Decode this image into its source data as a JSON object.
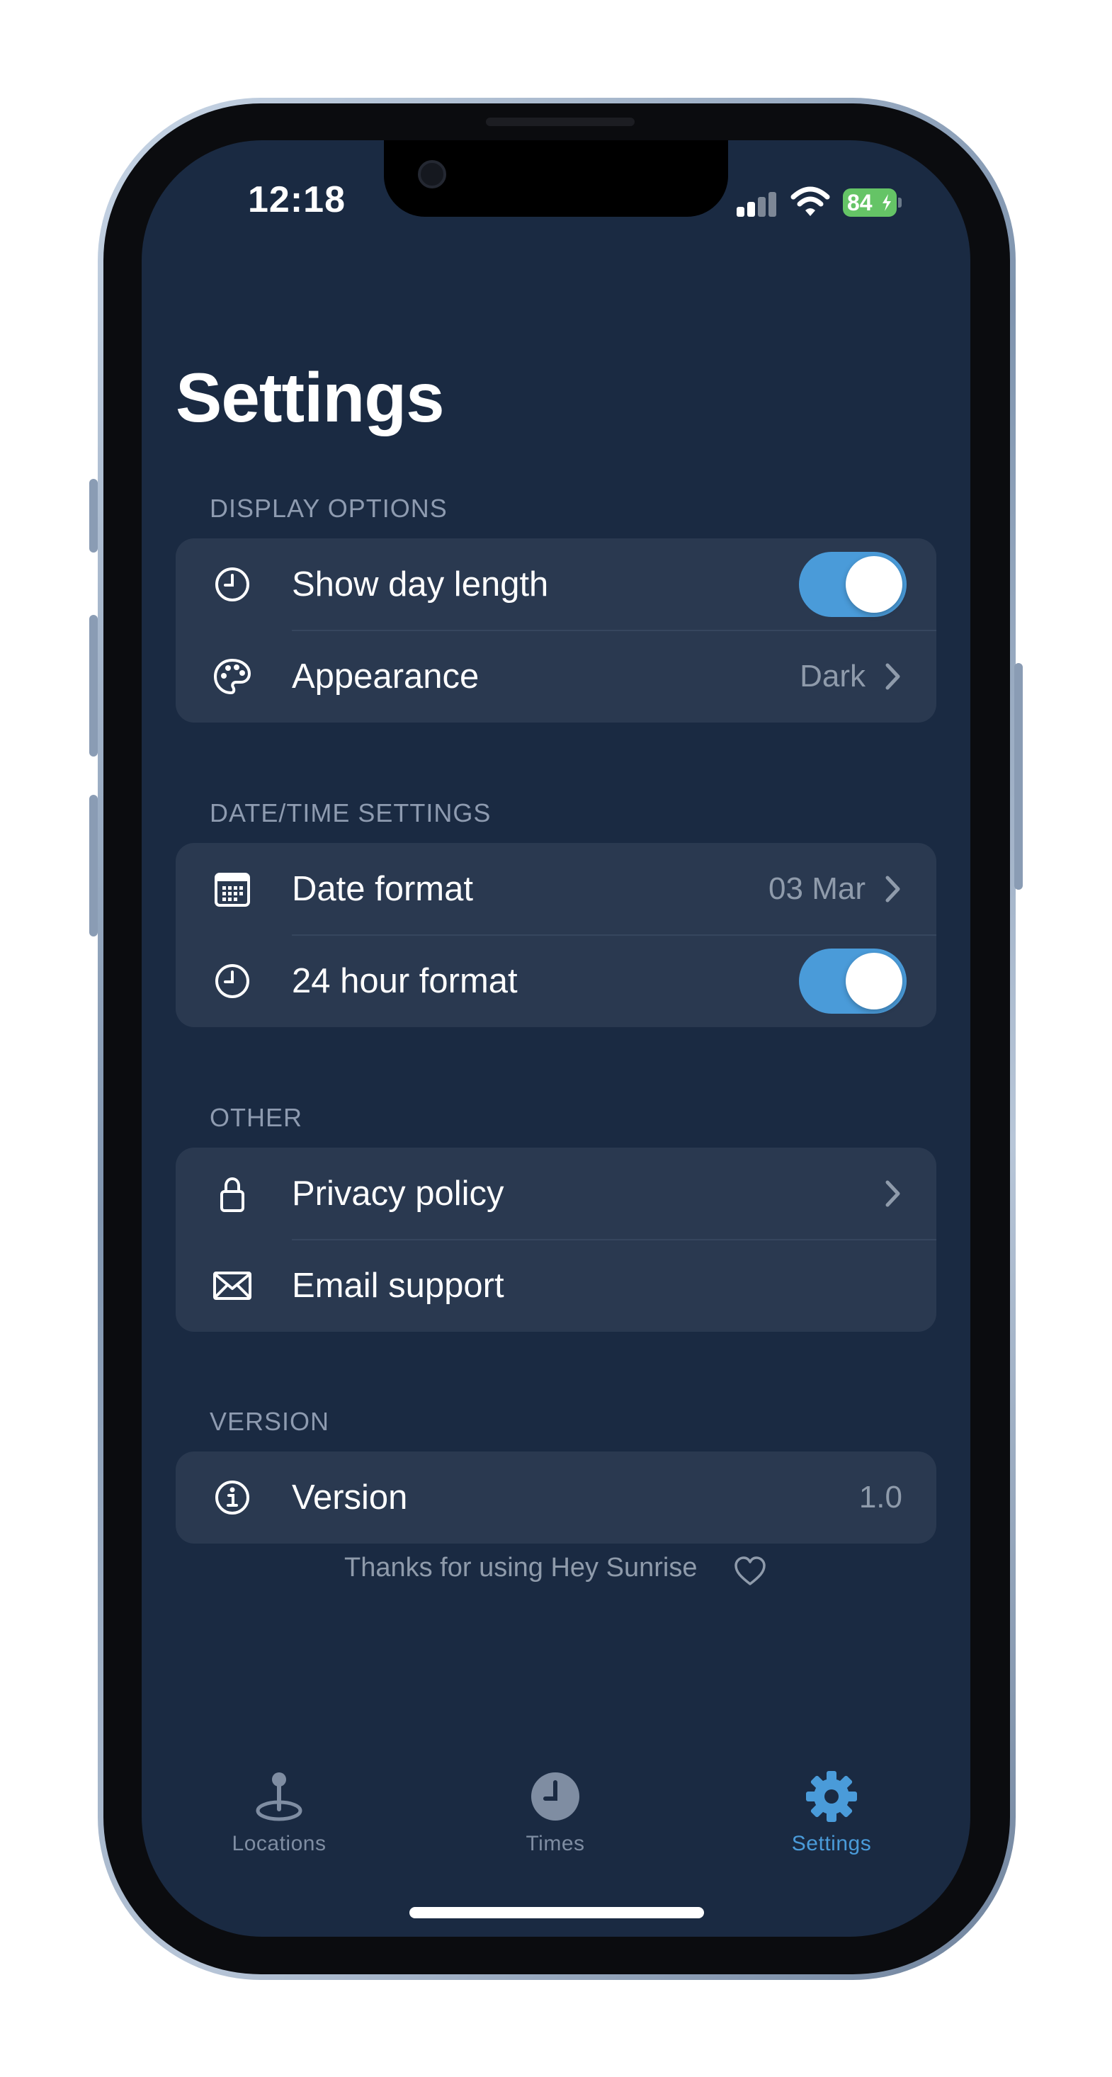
{
  "status_bar": {
    "time": "12:18",
    "battery": "84"
  },
  "page": {
    "title": "Settings"
  },
  "sections": [
    {
      "header": "DISPLAY OPTIONS"
    },
    {
      "header": "DATE/TIME SETTINGS"
    },
    {
      "header": "OTHER"
    },
    {
      "header": "VERSION"
    }
  ],
  "rows": {
    "show_day_length": {
      "label": "Show day length",
      "icon": "clock-icon",
      "toggle_on": true
    },
    "appearance": {
      "label": "Appearance",
      "value": "Dark",
      "icon": "palette-icon"
    },
    "date_format": {
      "label": "Date format",
      "value": "03 Mar",
      "icon": "calendar-icon"
    },
    "hour_format": {
      "label": "24 hour format",
      "icon": "clock-icon",
      "toggle_on": true
    },
    "privacy_policy": {
      "label": "Privacy policy",
      "icon": "lock-icon"
    },
    "email_support": {
      "label": "Email support",
      "icon": "envelope-icon"
    },
    "version": {
      "label": "Version",
      "value": "1.0",
      "icon": "info-icon"
    }
  },
  "footer": {
    "note": "Thanks for using Hey Sunrise",
    "icon": "heart-icon"
  },
  "tabs": [
    {
      "label": "Locations",
      "icon": "location-pin-icon",
      "active": false
    },
    {
      "label": "Times",
      "icon": "clock-icon",
      "active": false
    },
    {
      "label": "Settings",
      "icon": "gear-icon",
      "active": true
    }
  ],
  "colors": {
    "background": "#1a2a42",
    "card": "#2a3950",
    "accent": "#4a9bd9",
    "secondary_text": "#8f9bab",
    "battery": "#65c466"
  }
}
